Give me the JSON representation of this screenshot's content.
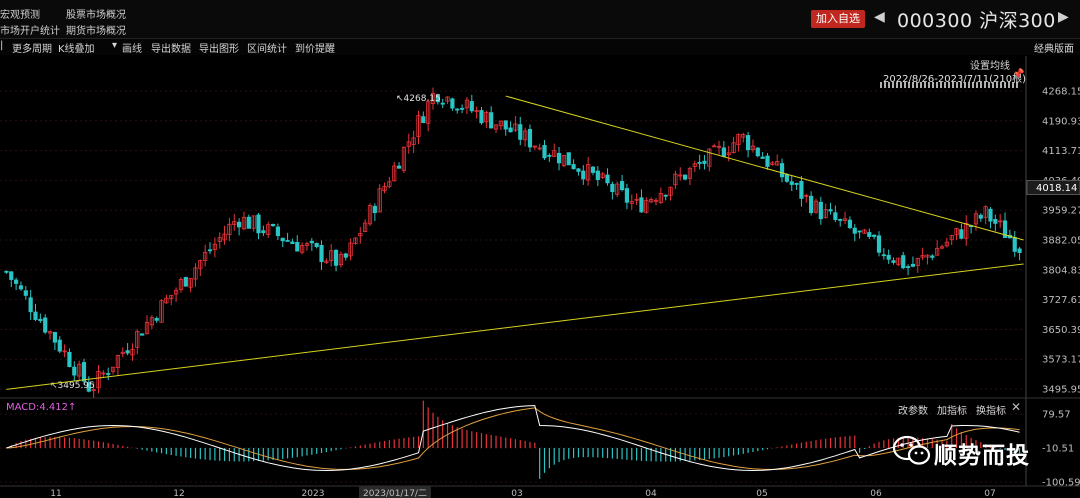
{
  "nav": {
    "top_left_1": "宏观预测",
    "top_left_2": "市场开户统计",
    "top_mid_1": "股票市场概况",
    "top_mid_2": "期货市场概况"
  },
  "header": {
    "add_watch": "加入自选",
    "prev_arrow": "◀",
    "next_arrow": "▶",
    "stock": "000300 沪深300"
  },
  "toolbar": {
    "more_period": "更多周期",
    "k_overlay": "K线叠加",
    "draw": "画线",
    "export_data": "导出数据",
    "export_graph": "导出图形",
    "range_stat": "区间统计",
    "price_alert": "到价提醒",
    "classic": "经典版面"
  },
  "chart_info": {
    "set_ma": "设置均线",
    "range_text": "2022/8/26-2023/7/11(210根)"
  },
  "macd": {
    "label": "MACD:4.412↑",
    "change_params": "改参数",
    "add_indicator": "加指标",
    "swap_indicator": "换指标",
    "close": "✕"
  },
  "colors": {
    "up": "#e8333a",
    "down": "#2bc4c4",
    "trendline": "#d6d41e",
    "dif": "#ffffff",
    "dea": "#e0a040",
    "grid": "#2a1010"
  },
  "watermark": {
    "icon": "wechat-icon",
    "text": "顺势而投"
  },
  "chart_data": [
    {
      "type": "candlestick",
      "title": "",
      "x_ticks": [
        "11",
        "12",
        "2023",
        "2023/01/17/二",
        "03",
        "04",
        "05",
        "06",
        "07"
      ],
      "y_ticks": [
        4268.15,
        4190.93,
        4113.71,
        4036.49,
        3959.27,
        3882.05,
        3804.83,
        3727.61,
        3650.39,
        3573.17,
        3495.95
      ],
      "ylim": [
        3480,
        4290
      ],
      "current_price": 4018.14,
      "annotations": [
        {
          "text": "4268.15",
          "value": 4268.15,
          "kind": "high"
        },
        {
          "text": "3495.95",
          "value": 3495.95,
          "kind": "low"
        }
      ],
      "key_points": [
        {
          "label": "start",
          "close": 3800
        },
        {
          "label": "low",
          "close": 3496
        },
        {
          "label": "early-dec",
          "close": 3940
        },
        {
          "label": "late-dec",
          "close": 3820
        },
        {
          "label": "jan-high",
          "close": 4268
        },
        {
          "label": "feb",
          "close": 4080
        },
        {
          "label": "mar",
          "close": 3970
        },
        {
          "label": "apr",
          "close": 4150
        },
        {
          "label": "may",
          "close": 3960
        },
        {
          "label": "late-may",
          "close": 3810
        },
        {
          "label": "jun",
          "close": 3950
        },
        {
          "label": "jul",
          "close": 3865
        }
      ],
      "trendlines": [
        {
          "name": "",
          "from": [
            0,
            3495
          ],
          "to": [
            209,
            3820
          ]
        },
        {
          "name": "",
          "from": [
            103,
            4255
          ],
          "to": [
            209,
            3882
          ]
        }
      ]
    },
    {
      "type": "bar",
      "title": "MACD",
      "y_ticks": [
        79.57,
        -10.51,
        -100.59
      ],
      "ylim": [
        -110,
        90
      ],
      "current": 4.412
    }
  ]
}
